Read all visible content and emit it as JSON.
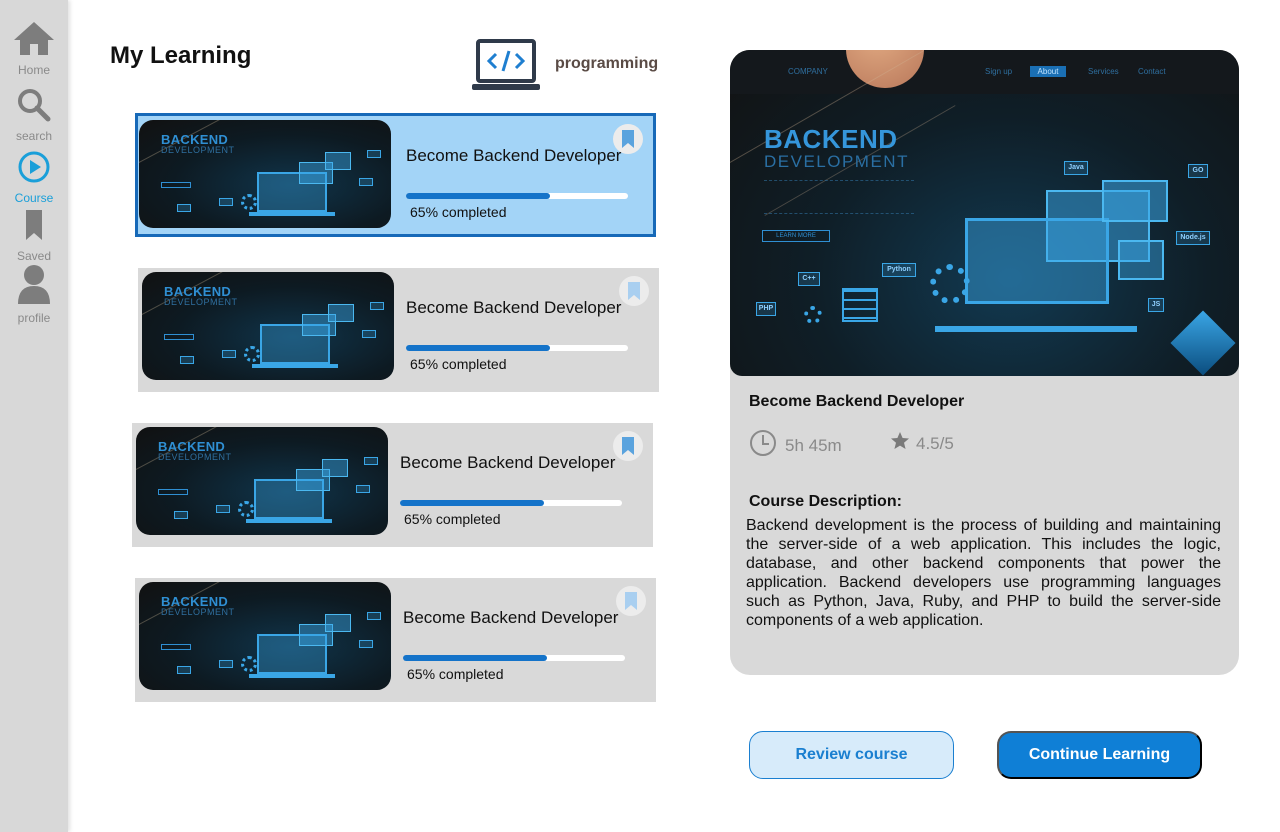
{
  "sidebar": {
    "items": [
      {
        "label": "Home",
        "icon": "home-icon"
      },
      {
        "label": "search",
        "icon": "search-icon"
      },
      {
        "label": "Course",
        "icon": "play-circle-icon",
        "active": true
      },
      {
        "label": "Saved",
        "icon": "bookmark-icon"
      },
      {
        "label": "profile",
        "icon": "user-icon"
      }
    ]
  },
  "header": {
    "title": "My Learning",
    "category_icon": "laptop-code-icon",
    "category": "programming"
  },
  "thumbnail": {
    "big": "BACKEND",
    "small": "DEVELOPMENT"
  },
  "courses": [
    {
      "title": "Become Backend Developer",
      "progress": 0.65,
      "progress_text": "65% completed",
      "selected": true,
      "bookmarked": true
    },
    {
      "title": "Become Backend Developer",
      "progress": 0.65,
      "progress_text": "65% completed",
      "selected": false,
      "bookmarked": false
    },
    {
      "title": "Become Backend Developer",
      "progress": 0.65,
      "progress_text": "65% completed",
      "selected": false,
      "bookmarked": true
    },
    {
      "title": "Become Backend Developer",
      "progress": 0.65,
      "progress_text": "65% completed",
      "selected": false,
      "bookmarked": false
    }
  ],
  "detail": {
    "hero": {
      "company": "COMPANY",
      "nav": [
        "Sign up",
        "About",
        "Services",
        "Contact"
      ],
      "big": "BACKEND",
      "small": "DEVELOPMENT",
      "learn_more": "LEARN MORE",
      "chips": [
        "Java",
        "GO",
        "Node.js",
        "Python",
        "C++",
        "PHP",
        "JS"
      ]
    },
    "title": "Become Backend Developer",
    "duration": "5h 45m",
    "rating": "4.5/5",
    "description_title": "Course Description:",
    "description": "Backend development is the process of building and maintaining the server-side of a web application. This includes the logic, database, and other backend components that power the application. Backend developers use programming languages such as Python, Java, Ruby, and PHP to build the server-side components of a web application."
  },
  "actions": {
    "review": "Review course",
    "continue": "Continue Learning"
  },
  "colors": {
    "accent": "#0f7fd6",
    "selected_card": "#a3d4f7",
    "card_bg": "#d9d9d9",
    "active_nav": "#1a9fd9"
  }
}
